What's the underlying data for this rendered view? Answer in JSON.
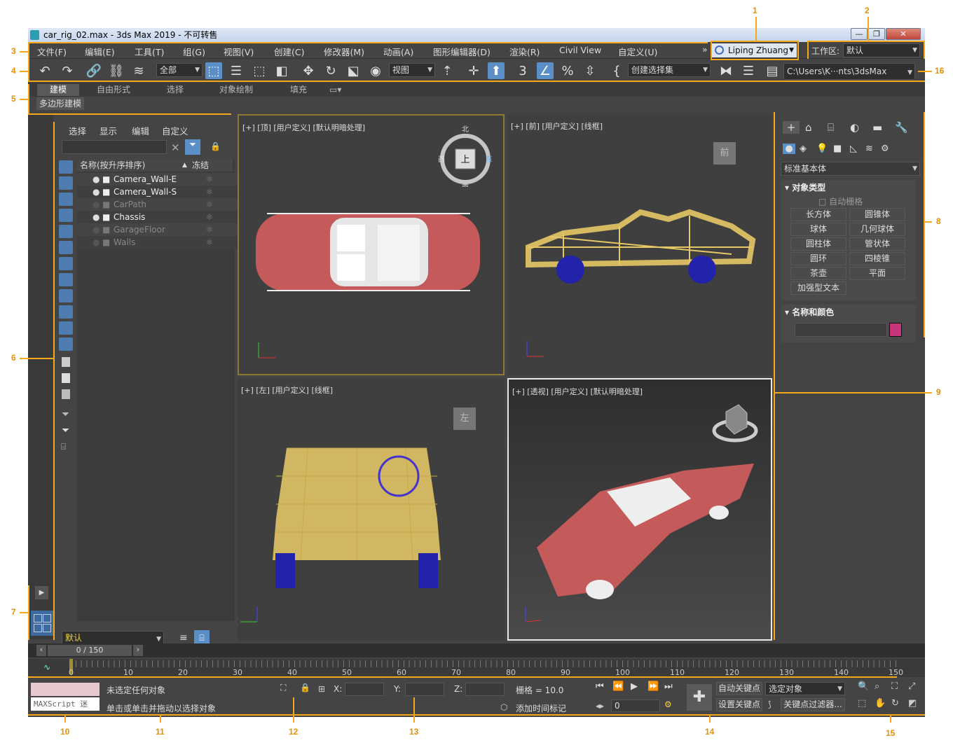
{
  "title": "car_rig_02.max - 3ds Max 2019  - 不可转售",
  "window_buttons": [
    "—",
    "❐",
    "✕"
  ],
  "menu": [
    "文件(F)",
    "编辑(E)",
    "工具(T)",
    "组(G)",
    "视图(V)",
    "创建(C)",
    "修改器(M)",
    "动画(A)",
    "图形编辑器(D)",
    "渲染(R)",
    "Civil View",
    "自定义(U)"
  ],
  "menu_more": "»",
  "user": "Liping Zhuang",
  "workspace_label": "工作区:",
  "workspace_value": "默认",
  "toolbar": {
    "filter_combo": "全部",
    "ref_coord_combo": "视图",
    "selset_combo": "创建选择集",
    "path": "C:\\Users\\K···nts\\3dsMax"
  },
  "ribbon": {
    "tabs": [
      "建模",
      "自由形式",
      "选择",
      "对象绘制",
      "填充"
    ],
    "sub": "多边形建模"
  },
  "scene_explorer": {
    "menus": [
      "选择",
      "显示",
      "编辑",
      "自定义"
    ],
    "col_name": "名称(按升序排序)",
    "col_sort": "▲",
    "col_freeze": "冻结",
    "rows": [
      "Camera_Wall-E",
      "Camera_Wall-S",
      "CarPath",
      "Chassis",
      "GarageFloor",
      "Walls"
    ],
    "layer": "默认"
  },
  "viewports": {
    "top": "[+] [顶] [用户定义] [默认明暗处理]",
    "front": "[+] [前] [用户定义] [线框]",
    "left": "[+] [左] [用户定义] [线框]",
    "persp": "[+] [透视] [用户定义] [默认明暗处理]",
    "viewcube_top": "上",
    "viewcube_front": "前",
    "viewcube_left": "左",
    "compass": {
      "n": "北",
      "s": "南",
      "e": "东",
      "w": "西"
    }
  },
  "command_panel": {
    "category": "标准基本体",
    "rollout1": "对象类型",
    "autogrid": "自动栅格",
    "buttons": [
      "长方体",
      "圆锥体",
      "球体",
      "几何球体",
      "圆柱体",
      "管状体",
      "圆环",
      "四棱锥",
      "茶壶",
      "平面",
      "加强型文本"
    ],
    "rollout2": "名称和颜色",
    "swatch_color": "#c8367a"
  },
  "timeline": {
    "frame": "0 / 150",
    "ticks": [
      "0",
      "10",
      "20",
      "30",
      "40",
      "50",
      "60",
      "70",
      "80",
      "90",
      "100",
      "110",
      "120",
      "130",
      "140",
      "150"
    ]
  },
  "status": {
    "maxscript": "MAXScript 迷",
    "line1": "未选定任何对象",
    "line2": "单击或单击并拖动以选择对象",
    "x": "X:",
    "y": "Y:",
    "z": "Z:",
    "grid": "栅格 = 10.0",
    "add_tag": "添加时间标记",
    "frame_field": "0",
    "autokey": "自动关键点",
    "setkey": "设置关键点",
    "selected": "选定对象",
    "key_filter": "关键点过滤器..."
  },
  "callouts": [
    "1",
    "2",
    "3",
    "4",
    "5",
    "6",
    "7",
    "8",
    "9",
    "10",
    "11",
    "12",
    "13",
    "14",
    "15",
    "16"
  ],
  "colors": {
    "accent": "#f5a91a",
    "select_blue": "#5b8fc7",
    "wire_yellow": "#e6c866",
    "car_red": "#c45a5a"
  }
}
